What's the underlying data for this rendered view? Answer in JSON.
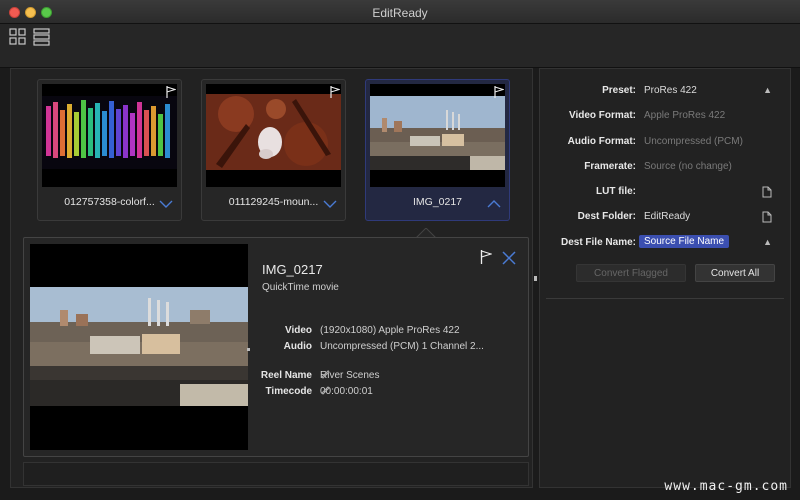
{
  "window": {
    "title": "EditReady"
  },
  "toolbar": {
    "grid_view_icon": "grid-icon",
    "list_view_icon": "list-icon"
  },
  "clips": [
    {
      "name": "012757358-colorf...",
      "selected": false
    },
    {
      "name": "011129245-moun...",
      "selected": false
    },
    {
      "name": "IMG_0217",
      "selected": true
    }
  ],
  "detail": {
    "title": "IMG_0217",
    "subtitle": "QuickTime movie",
    "video_label": "Video",
    "video_value": "(1920x1080) Apple ProRes 422",
    "audio_label": "Audio",
    "audio_value": "Uncompressed (PCM) 1 Channel 2...",
    "reel_label": "Reel Name",
    "reel_value": "River Scenes",
    "timecode_label": "Timecode",
    "timecode_value": "00:00:00:01"
  },
  "settings": {
    "preset_label": "Preset:",
    "preset_value": "ProRes 422",
    "video_format_label": "Video Format:",
    "video_format_value": "Apple ProRes 422",
    "audio_format_label": "Audio Format:",
    "audio_format_value": "Uncompressed (PCM)",
    "framerate_label": "Framerate:",
    "framerate_value": "Source (no change)",
    "lut_label": "LUT file:",
    "lut_value": "",
    "dest_folder_label": "Dest Folder:",
    "dest_folder_value": "EditReady",
    "dest_file_label": "Dest File Name:",
    "dest_file_value": "Source File Name",
    "convert_flagged": "Convert Flagged",
    "convert_all": "Convert All"
  },
  "watermark": "www.mac-gm.com",
  "colors": {
    "accent": "#3b4fb0",
    "selected_card": "#2f3a7a"
  }
}
